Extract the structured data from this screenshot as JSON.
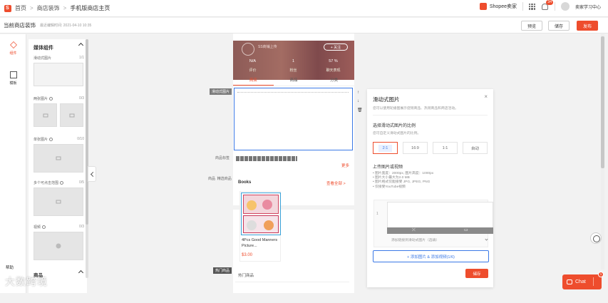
{
  "breadcrumb": {
    "home": "首页",
    "level1": "商店装饰",
    "current": "手机版商店主页"
  },
  "header": {
    "seller_center": "Shopee卖家",
    "notif_count": "34",
    "learning": "卖家学习中心"
  },
  "subheader": {
    "title": "当前商店装饰",
    "saved": "最近编辑时间: 2021-04-10 10:35",
    "preview": "预览",
    "save": "储存",
    "publish": "发布"
  },
  "rail": {
    "components": "组件",
    "templates": "模板",
    "help": "帮助"
  },
  "panel": {
    "title": "媒体组件",
    "items": [
      {
        "label": "滑动式图片",
        "count": "1/1"
      },
      {
        "label": "两张图片",
        "count": "0/3"
      },
      {
        "label": "单张图片",
        "count": "0/10"
      },
      {
        "label": "多个可点击范围",
        "count": "0/5"
      },
      {
        "label": "视频",
        "count": "0/3"
      }
    ],
    "products": "商品"
  },
  "shop": {
    "name": "SS商铺上传",
    "follow": "+ 关注",
    "stats": [
      {
        "value": "N/A",
        "label": "评价"
      },
      {
        "value": "1",
        "label": "粉丝"
      },
      {
        "value": "57 %",
        "label": "聊天表现"
      }
    ],
    "tabs": [
      "商店",
      "商品",
      "分类"
    ],
    "carousel_tag": "滑动式图片",
    "hashtag_label": "商品标签",
    "more": "更多",
    "product_tag": "商品",
    "product_tag2": "精选商品",
    "section_title": "Books",
    "see_all": "查看全部 >",
    "product": {
      "name": "4Pcs Good Manners Picture...",
      "price": "$3.00"
    },
    "hot_tag": "热门商品",
    "hot_title": "热门商品"
  },
  "settings": {
    "title": "滑动式图片",
    "desc": "您可以使用轮播图展示促销商品、热销商品和商店活动。",
    "ratio_title": "选择滑动式图片的比例",
    "ratio_sub": "您可自定义滑动式图片的比例。",
    "ratios": [
      "2:1",
      "16:9",
      "1:1",
      "自动"
    ],
    "upload_title": "上传图片或视频",
    "specs": [
      "• 图片宽度：2000px, 图片高度：1000px",
      "• 图片大小最大为2.0 MB",
      "• 图片格式仅能接受 JPG, JPEG, PNG",
      "• 仅接受YouTube视频"
    ],
    "media_index": "1",
    "select_placeholder": "添加链接到滑动式图片（选填）",
    "add_button": "+ 添加图片 & 添加视频(1/6)",
    "save": "储存"
  },
  "chat": {
    "label": "Chat",
    "badge": "1"
  },
  "watermark": "大数跨境"
}
